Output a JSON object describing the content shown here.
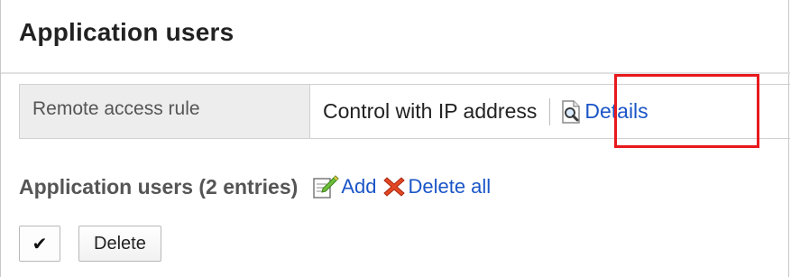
{
  "page": {
    "title": "Application users"
  },
  "remote_access": {
    "label": "Remote access rule",
    "value": "Control with IP address",
    "details_link": "Details"
  },
  "users_section": {
    "heading": "Application users (2 entries)",
    "add_label": "Add",
    "delete_all_label": "Delete all"
  },
  "controls": {
    "select_all_symbol": "✔",
    "delete_label": "Delete"
  },
  "colors": {
    "link": "#1b56c7",
    "highlight": "#e8191d",
    "delete_icon": "#e34623",
    "label_cell_bg": "#ededed"
  },
  "icons": {
    "details": "magnifier-document-icon",
    "add": "add-edit-icon",
    "delete_all": "red-x-icon",
    "select_all": "checkmark-icon"
  }
}
